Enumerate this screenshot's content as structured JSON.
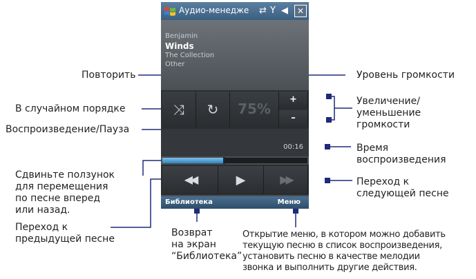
{
  "device": {
    "title": "Аудио-менеджe",
    "icons": [
      "windows-flag-icon",
      "connectivity-icon",
      "no-signal-icon",
      "speaker-icon",
      "close-icon"
    ],
    "close_label": "✕",
    "track": {
      "artist": "Benjamin",
      "title": "Winds",
      "album": "The Collection",
      "genre": "Other"
    },
    "volume_percent": "75%",
    "volume_up": "+",
    "volume_down": "–",
    "elapsed_time": "00:16",
    "seek_progress": 0.43,
    "softkeys": {
      "left": "Библиотека",
      "right": "Меню"
    }
  },
  "callouts": {
    "repeat": "Повторить",
    "shuffle": "В случайном порядке",
    "play_pause": "Воспроизведение/Пауза",
    "seek": "Сдвиньте ползунок\nдля перемещения\nпо песне вперед\nили назад.",
    "previous": "Переход к\nпредыдущей песне",
    "library_return": "Возврат\nна экран\n“Библиотека”",
    "volume_level": "Уровень громкости",
    "volume_adjust": "Увеличение/\nуменьшение\nгромкости",
    "play_time": "Время\nвоспроизведения",
    "next": "Переход к\nследующей песне",
    "menu": "Открытие меню, в котором можно добавить\nтекущую песню в список воспроизведения,\nустановить песню в качестве мелодии\nзвонка и выполнить другие действия."
  },
  "colors": {
    "leader_line": "#1f2a7a",
    "seek_fill": "#3a9ad8",
    "titlebar": "#4a6f92"
  }
}
